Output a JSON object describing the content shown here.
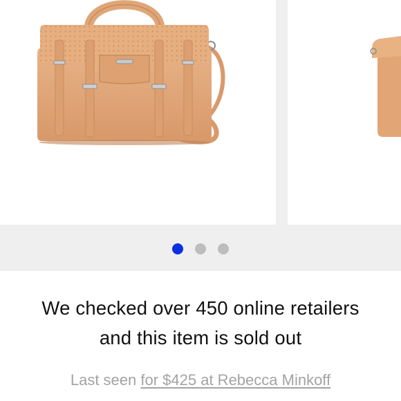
{
  "carousel": {
    "slide_count": 3,
    "active_index": 0,
    "colors": {
      "active_dot": "#0a2fe3",
      "inactive_dot": "#bdbdbd",
      "background": "#efefef"
    }
  },
  "status": {
    "line1": "We checked over 450 online retailers",
    "line2": "and this item is sold out"
  },
  "last_seen": {
    "prefix": "Last seen",
    "link_text": "for $425 at Rebecca Minkoff"
  },
  "product": {
    "color": "#e0a676"
  }
}
